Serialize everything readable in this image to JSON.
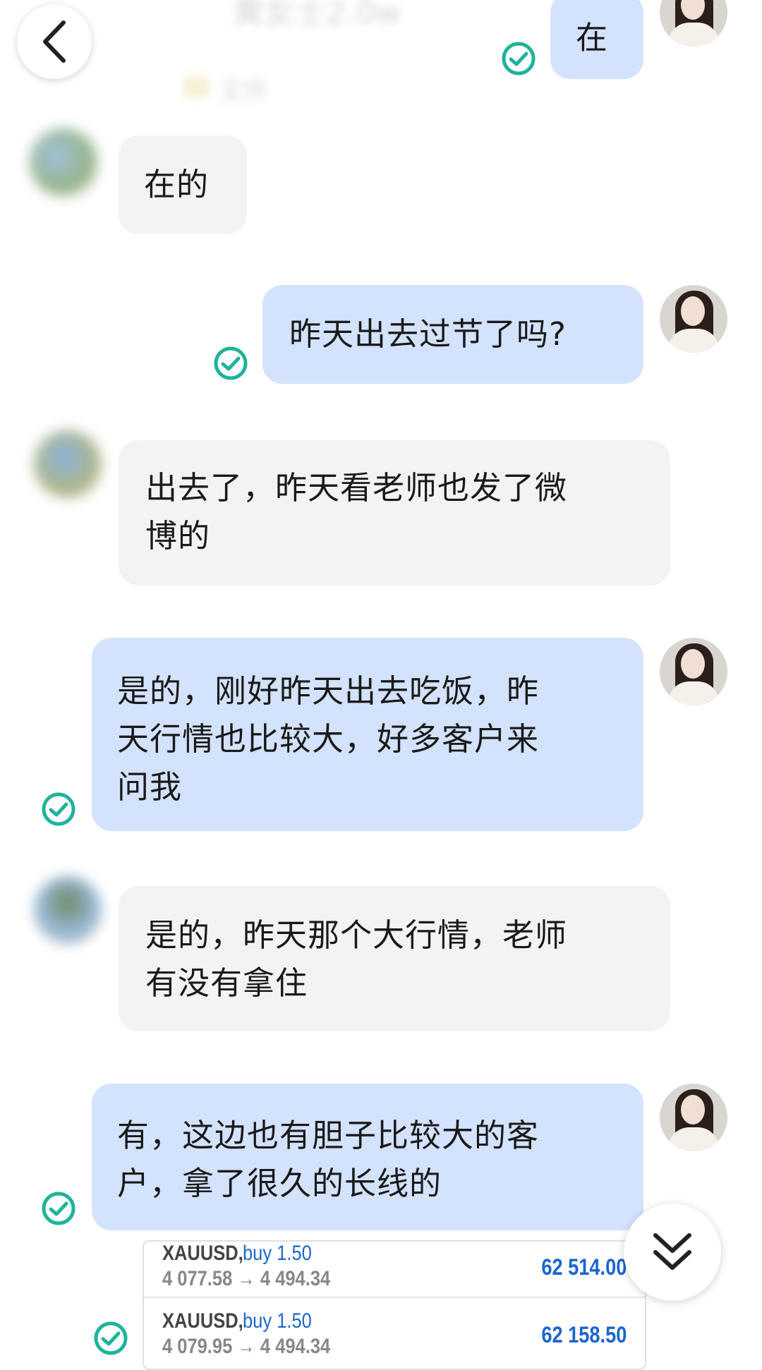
{
  "header": {
    "title": "黄女士2.0w",
    "file_tab": "文件"
  },
  "messages": [
    {
      "side": "out",
      "text": "在"
    },
    {
      "side": "in",
      "text": "在的"
    },
    {
      "side": "out",
      "text": "昨天出去过节了吗?"
    },
    {
      "side": "in",
      "lines": [
        "出去了，昨天看老师也发了微",
        "博的"
      ]
    },
    {
      "side": "out",
      "lines": [
        "是的，刚好昨天出去吃饭，昨",
        "天行情也比较大，好多客户来",
        "问我"
      ]
    },
    {
      "side": "in",
      "lines": [
        "是的，昨天那个大行情，老师",
        "有没有拿住"
      ]
    },
    {
      "side": "out",
      "lines": [
        "有，这边也有胆子比较大的客",
        "户，拿了很久的长线的"
      ]
    }
  ],
  "trades": [
    {
      "symbol": "XAUUSD,",
      "direction": "buy 1.50",
      "prices": "4 077.58 → 4 494.34",
      "profit": "62 514.00"
    },
    {
      "symbol": "XAUUSD,",
      "direction": "buy 1.50",
      "prices": "4 079.95 → 4 494.34",
      "profit": "62 158.50"
    }
  ],
  "icons": {
    "back": "chevron-left-icon",
    "scroll_down": "double-chevron-down-icon",
    "read_receipt": "check-circle-icon"
  },
  "colors": {
    "outgoing_bubble": "#d4e3fd",
    "incoming_bubble": "#f2f3f5",
    "check_green": "#1fb39a",
    "trade_blue": "#1a66cc"
  }
}
